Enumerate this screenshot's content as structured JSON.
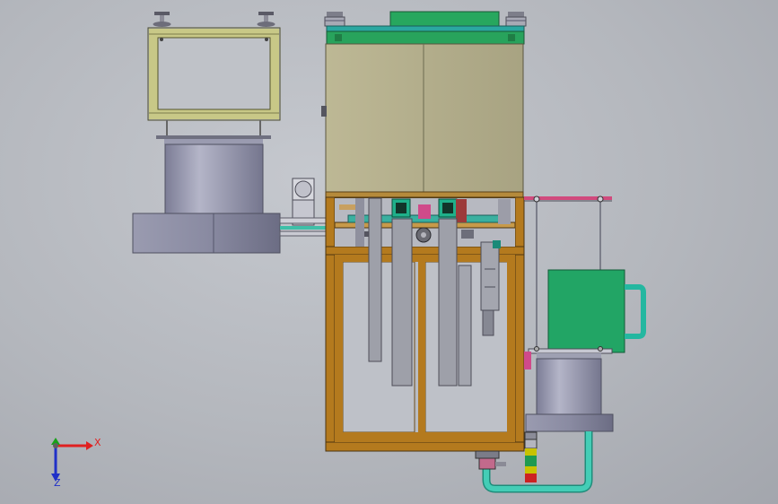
{
  "triad": {
    "x_label": "X",
    "y_label": "Y",
    "z_label": "Z",
    "x_color": "#e02020",
    "y_color": "#18a018",
    "z_color": "#2030c8"
  },
  "colors": {
    "frame_olive": "#c9c98a",
    "cabinet": "#b3ae8c",
    "frame_wood": "#b47a1e",
    "green_panel": "#1fa05a",
    "pipe": "#3ac7b0",
    "cylinder": "#8e8fa6"
  }
}
